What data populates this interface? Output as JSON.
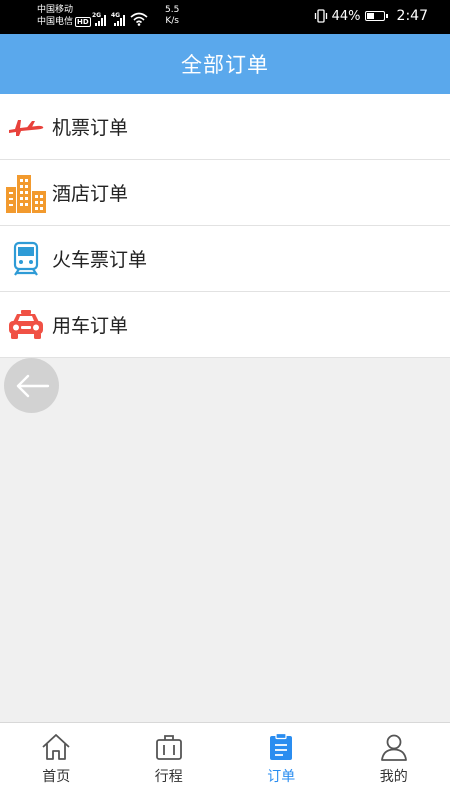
{
  "status_bar": {
    "carrier1": "中国移动",
    "carrier2": "中国电信",
    "hd_badge": "HD",
    "signal1_label": "2G",
    "signal2_label": "4G",
    "speed_value": "5.5",
    "speed_unit": "K/s",
    "battery_percent": "44%",
    "battery_level": 0.44,
    "time": "2:47"
  },
  "header": {
    "title": "全部订单"
  },
  "order_list": {
    "items": [
      {
        "label": "机票订单",
        "icon": "airplane-icon",
        "color": "#e8413b"
      },
      {
        "label": "酒店订单",
        "icon": "hotel-building-icon",
        "color": "#f29a2e"
      },
      {
        "label": "火车票订单",
        "icon": "train-icon",
        "color": "#2e9bd6"
      },
      {
        "label": "用车订单",
        "icon": "car-icon",
        "color": "#f05145"
      }
    ]
  },
  "tab_bar": {
    "active_color": "#2a8df0",
    "items": [
      {
        "label": "首页",
        "icon": "home-icon",
        "active": false
      },
      {
        "label": "行程",
        "icon": "suitcase-icon",
        "active": false
      },
      {
        "label": "订单",
        "icon": "clipboard-icon",
        "active": true
      },
      {
        "label": "我的",
        "icon": "user-icon",
        "active": false
      }
    ]
  },
  "colors": {
    "header_bg": "#5aa8ec",
    "page_bg": "#f0f0f0"
  }
}
